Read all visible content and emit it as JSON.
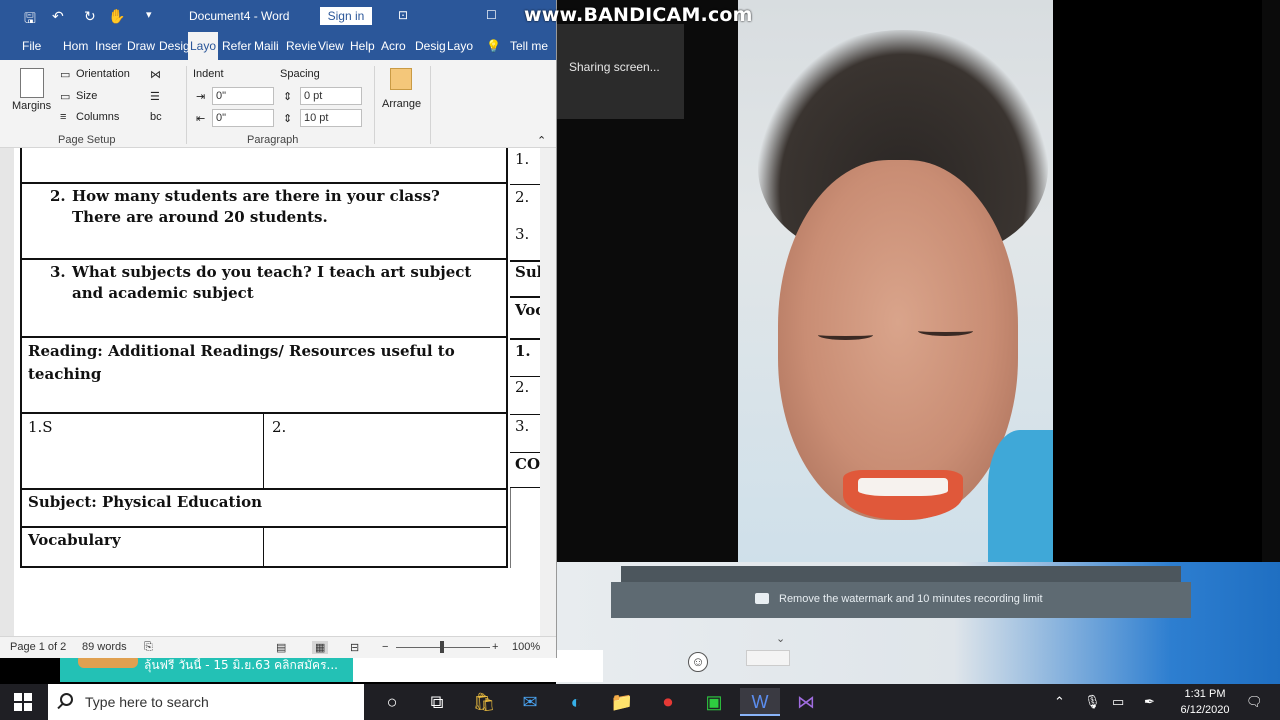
{
  "watermark": {
    "text": "www.BANDICAM.com"
  },
  "sharing": {
    "label": "Sharing screen..."
  },
  "recording_bar": {
    "message": "Remove the watermark and 10 minutes recording limit"
  },
  "chat": {
    "preview": "ลุ้นฟรี วันนี้ - 15 มิ.ย.63 คลิกสมัคร..."
  },
  "word": {
    "title": "Document4 - Word",
    "signin_label": "Sign in",
    "tabs": [
      "File",
      "Hom",
      "Inser",
      "Draw",
      "Desig",
      "Layo",
      "Refer",
      "Maili",
      "Revie",
      "View",
      "Help",
      "Acro",
      "Desig",
      "Layo",
      "Tell me"
    ],
    "ribbon": {
      "margins": "Margins",
      "orientation": "Orientation",
      "size": "Size",
      "columns": "Columns",
      "page_setup": "Page Setup",
      "indent": "Indent",
      "spacing": "Spacing",
      "indent_left": "0\"",
      "indent_right": "0\"",
      "spacing_before": "0 pt",
      "spacing_after": "10 pt",
      "paragraph": "Paragraph",
      "arrange": "Arrange"
    },
    "doc": {
      "q2_num": "2.",
      "q2": "How many students are there in your class? There are around 20 students.",
      "q3_num": "3.",
      "q3": "What subjects do you teach?  I teach art subject and academic subject",
      "reading": "Reading:  Additional Readings/ Resources useful to teaching",
      "cell_1": "1.S",
      "cell_2": "2.",
      "subject": "Subject: Physical Education",
      "vocabulary": "Vocabulary",
      "right_col": [
        "1.",
        "2.",
        "3.",
        "Sub",
        "Voc",
        "1.",
        "2.",
        "3.",
        "COI"
      ]
    },
    "status": {
      "page": "Page 1 of 2",
      "words": "89 words",
      "zoom": "100%"
    }
  },
  "taskbar": {
    "search_placeholder": "Type here to search",
    "time": "1:31 PM",
    "date": "6/12/2020"
  }
}
